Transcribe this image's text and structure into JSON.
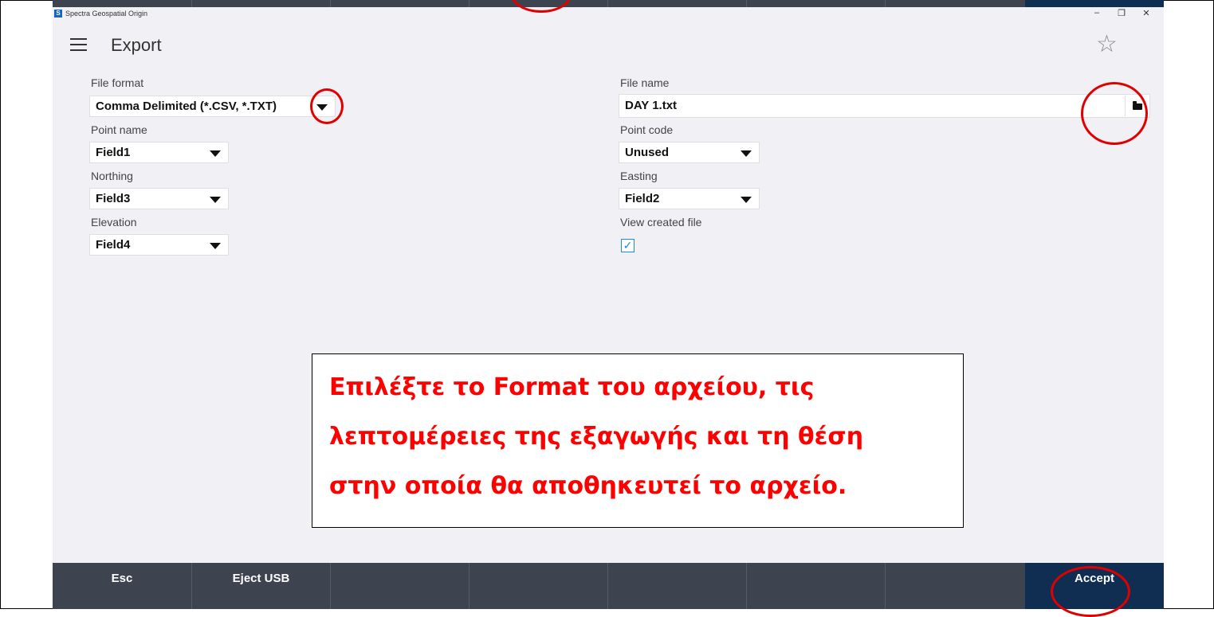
{
  "window": {
    "app_title": "Spectra Geospatial Origin",
    "controls": {
      "minimize": "–",
      "restore": "❐",
      "close": "✕"
    }
  },
  "header": {
    "title": "Export",
    "menu_icon": "hamburger-icon",
    "favorite_icon": "star-icon",
    "favorite_glyph": "☆"
  },
  "form": {
    "file_format": {
      "label": "File format",
      "value": "Comma Delimited (*.CSV, *.TXT)"
    },
    "file_name": {
      "label": "File name",
      "value": "DAY 1.txt",
      "browse_icon": "folder-icon"
    },
    "point_name": {
      "label": "Point name",
      "value": "Field1"
    },
    "point_code": {
      "label": "Point code",
      "value": "Unused"
    },
    "northing": {
      "label": "Northing",
      "value": "Field3"
    },
    "easting": {
      "label": "Easting",
      "value": "Field2"
    },
    "elevation": {
      "label": "Elevation",
      "value": "Field4"
    },
    "view_created_file": {
      "label": "View created file",
      "checked": true,
      "glyph": "✓"
    }
  },
  "instruction": {
    "line1": "Επιλέξτε το Format του αρχείου, τις",
    "line2": "λεπτομέρειες της εξαγωγής και τη θέση",
    "line3": "στην οποία θα αποθηκευτεί το αρχείο."
  },
  "toolbar": {
    "esc_label": "Esc",
    "eject_label": "Eject USB",
    "accept_label": "Accept"
  },
  "colors": {
    "toolbar_bg": "#3d4450",
    "accept_bg": "#0f2e52",
    "annotation_red": "#e00000",
    "checkbox_blue": "#1e88e5"
  }
}
